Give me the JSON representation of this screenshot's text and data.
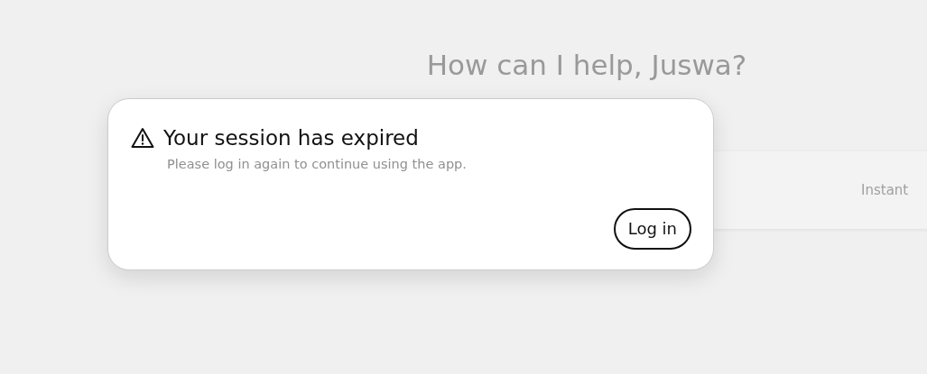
{
  "background": {
    "greeting": "How can I help, Juswa?",
    "composer": {
      "mode_label": "Instant"
    }
  },
  "dialog": {
    "title": "Your session has expired",
    "message": "Please log in again to continue using the app.",
    "button": "Log in"
  }
}
